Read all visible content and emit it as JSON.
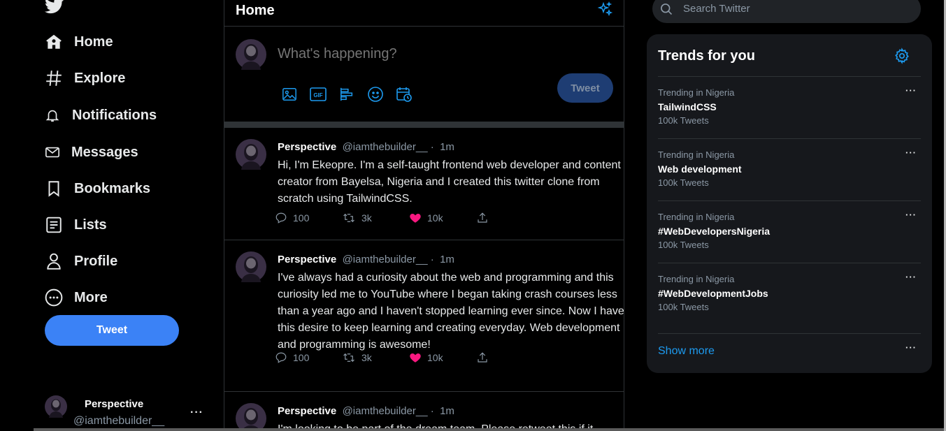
{
  "nav": {
    "items": [
      {
        "label": "Home",
        "icon": "home-icon"
      },
      {
        "label": "Explore",
        "icon": "hashtag-icon"
      },
      {
        "label": "Notifications",
        "icon": "bell-icon"
      },
      {
        "label": "Messages",
        "icon": "mail-icon"
      },
      {
        "label": "Bookmarks",
        "icon": "bookmark-icon"
      },
      {
        "label": "Lists",
        "icon": "list-icon"
      },
      {
        "label": "Profile",
        "icon": "person-icon"
      },
      {
        "label": "More",
        "icon": "more-circle-icon"
      }
    ],
    "tweet_button": "Tweet",
    "account": {
      "name": "Perspective",
      "handle": "@iamthebuilder__",
      "more": "···"
    }
  },
  "main": {
    "title": "Home",
    "compose": {
      "placeholder": "What's happening?",
      "button": "Tweet"
    },
    "tweets": [
      {
        "name": "Perspective",
        "handle": "@iamthebuilder__",
        "sep": "·",
        "time": "1m",
        "text": "Hi, I'm Ekeopre. I'm a self-taught frontend web developer and content creator from Bayelsa, Nigeria and I created this twitter clone from scratch using TailwindCSS.",
        "replies": "100",
        "retweets": "3k",
        "likes": "10k"
      },
      {
        "name": "Perspective",
        "handle": "@iamthebuilder__",
        "sep": "·",
        "time": "1m",
        "text": "I've always had a curiosity about the web and programming and this curiosity led me to YouTube where I began taking crash courses less than a year ago and I haven't stopped learning ever since. Now I have this desire to keep learning and creating everyday. Web development and programming is awesome!",
        "replies": "100",
        "retweets": "3k",
        "likes": "10k"
      },
      {
        "name": "Perspective",
        "handle": "@iamthebuilder__",
        "sep": "·",
        "time": "1m",
        "text": "I'm looking to be part of the dream team. Please retweet this if it",
        "replies": "",
        "retweets": "",
        "likes": ""
      }
    ]
  },
  "search": {
    "placeholder": "Search Twitter"
  },
  "trends": {
    "title": "Trends for you",
    "items": [
      {
        "context": "Trending in Nigeria",
        "topic": "TailwindCSS",
        "count": "100k Tweets"
      },
      {
        "context": "Trending in Nigeria",
        "topic": "Web development",
        "count": "100k Tweets"
      },
      {
        "context": "Trending in Nigeria",
        "topic": "#WebDevelopersNigeria",
        "count": "100k Tweets"
      },
      {
        "context": "Trending in Nigeria",
        "topic": "#WebDevelopmentJobs",
        "count": "100k Tweets"
      }
    ],
    "more": "···",
    "show_more": "Show more"
  },
  "colors": {
    "accent": "#1d9bf0",
    "tweet_button": "#3b82f6",
    "like": "#f91880",
    "background": "#000000",
    "panel": "#16181c"
  }
}
